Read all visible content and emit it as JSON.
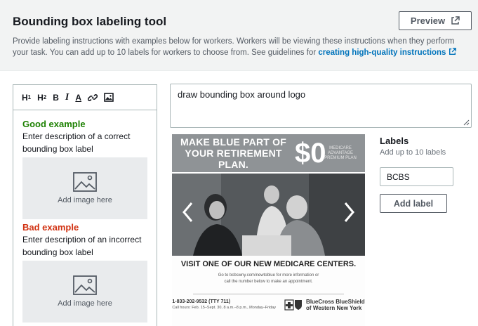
{
  "header": {
    "title": "Bounding box labeling tool",
    "preview_label": "Preview",
    "description": "Provide labeling instructions with examples below for workers. Workers will be viewing these instructions when they perform your task. You can add up to 10 labels for workers to choose from. See guidelines for",
    "link_text": "creating high-quality instructions"
  },
  "toolbar": {
    "h1": "H",
    "h1_sub": "1",
    "h2": "H",
    "h2_sub": "2",
    "bold": "B",
    "italic": "I",
    "text_color": "A",
    "icons": [
      "h1-icon",
      "h2-icon",
      "bold-icon",
      "italic-icon",
      "text-color-icon",
      "link-icon",
      "image-icon"
    ]
  },
  "examples": {
    "good_title": "Good example",
    "good_desc": "Enter description of a correct bounding box label",
    "bad_title": "Bad example",
    "bad_desc": "Enter description of an incorrect bounding box label",
    "add_image": "Add image here"
  },
  "instructions": {
    "value": "draw bounding box around logo"
  },
  "ad": {
    "headline": "MAKE BLUE PART OF YOUR RETIREMENT PLAN.",
    "big_number": "$0",
    "small_text": "MEDICARE ADVANTAGE PREMIUM PLAN",
    "heading": "VISIT ONE OF OUR NEW MEDICARE CENTERS.",
    "sub1": "Go to bcbswny.com/newtoblue for more information or",
    "sub2": "call the number below to make an appointment.",
    "phone": "1-833-202-9532 (TTY 711)",
    "hours": "Call hours: Feb. 15–Sept. 30, 8 a.m.–8 p.m., Monday–Friday",
    "brand1": "BlueCross BlueShield",
    "brand2": "of Western New York"
  },
  "labels": {
    "title": "Labels",
    "subtitle": "Add up to 10 labels",
    "items": [
      "BCBS"
    ],
    "add_label": "Add label"
  },
  "colors": {
    "good": "#1d8102",
    "bad": "#d13212",
    "link": "#0073bb",
    "header_bg": "#f2f3f3"
  }
}
